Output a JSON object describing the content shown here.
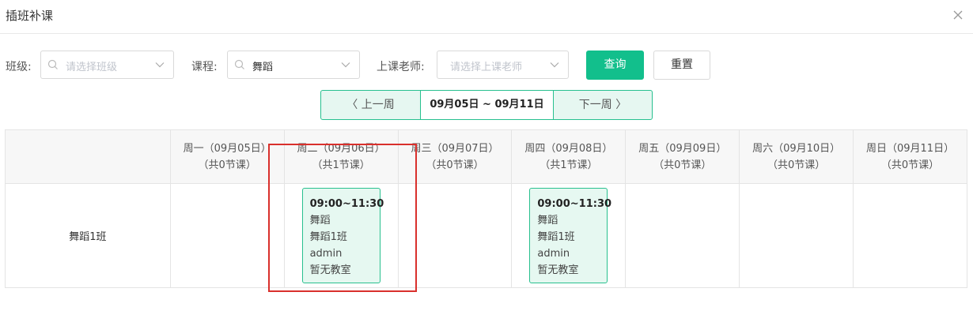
{
  "dialog": {
    "title": "插班补课",
    "close_icon": "close-icon"
  },
  "filters": {
    "class": {
      "label": "班级:",
      "placeholder": "请选择班级"
    },
    "course": {
      "label": "课程:",
      "value": "舞蹈"
    },
    "teacher": {
      "label": "上课老师:",
      "placeholder": "请选择上课老师"
    },
    "search_button": "查询",
    "reset_button": "重置"
  },
  "week_nav": {
    "prev": "〈 上一周",
    "current": "09月05日 ~ 09月11日",
    "next": "下一周 〉"
  },
  "schedule": {
    "days": [
      {
        "name": "周一（09月05日）",
        "count": "（共0节课）"
      },
      {
        "name": "周二（09月06日）",
        "count": "（共1节课）"
      },
      {
        "name": "周三（09月07日）",
        "count": "（共0节课）"
      },
      {
        "name": "周四（09月08日）",
        "count": "（共1节课）"
      },
      {
        "name": "周五（09月09日）",
        "count": "（共0节课）"
      },
      {
        "name": "周六（09月10日）",
        "count": "（共0节课）"
      },
      {
        "name": "周日（09月11日）",
        "count": "（共0节课）"
      }
    ],
    "rows": [
      {
        "class_name": "舞蹈1班",
        "lessons": {
          "tue": {
            "time": "09:00~11:30",
            "course": "舞蹈",
            "class": "舞蹈1班",
            "teacher": "admin",
            "room": "暂无教室"
          },
          "thu": {
            "time": "09:00~11:30",
            "course": "舞蹈",
            "class": "舞蹈1班",
            "teacher": "admin",
            "room": "暂无教室"
          }
        }
      }
    ]
  },
  "colors": {
    "primary": "#12bf8c",
    "card_border": "#28c08e",
    "card_bg": "#e6f8f1",
    "highlight": "#d9302c"
  }
}
